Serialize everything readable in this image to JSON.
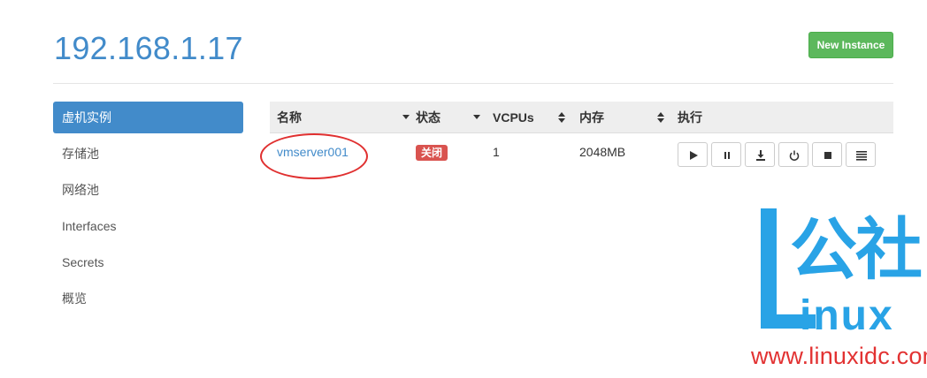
{
  "header": {
    "title": "192.168.1.17",
    "new_instance_label": "New Instance"
  },
  "sidebar": {
    "items": [
      {
        "label": "虚机实例",
        "active": true
      },
      {
        "label": "存储池",
        "active": false
      },
      {
        "label": "网络池",
        "active": false
      },
      {
        "label": "Interfaces",
        "active": false
      },
      {
        "label": "Secrets",
        "active": false
      },
      {
        "label": "概览",
        "active": false
      }
    ]
  },
  "table": {
    "columns": [
      "名称",
      "状态",
      "VCPUs",
      "内存",
      "执行"
    ],
    "rows": [
      {
        "name": "vmserver001",
        "status": "关闭",
        "vcpus": "1",
        "memory": "2048MB",
        "actions": [
          "play-icon",
          "pause-icon",
          "download-icon",
          "power-icon",
          "stop-icon",
          "menu-icon"
        ]
      }
    ]
  },
  "watermark": {
    "logo_text": "公社",
    "logo_suffix": "inux",
    "url": "www.linuxidc.com"
  },
  "colors": {
    "accent": "#428bca",
    "success": "#5cb85c",
    "danger": "#d9534f",
    "watermark_blue": "#29a3e6",
    "watermark_red": "#e23232"
  }
}
